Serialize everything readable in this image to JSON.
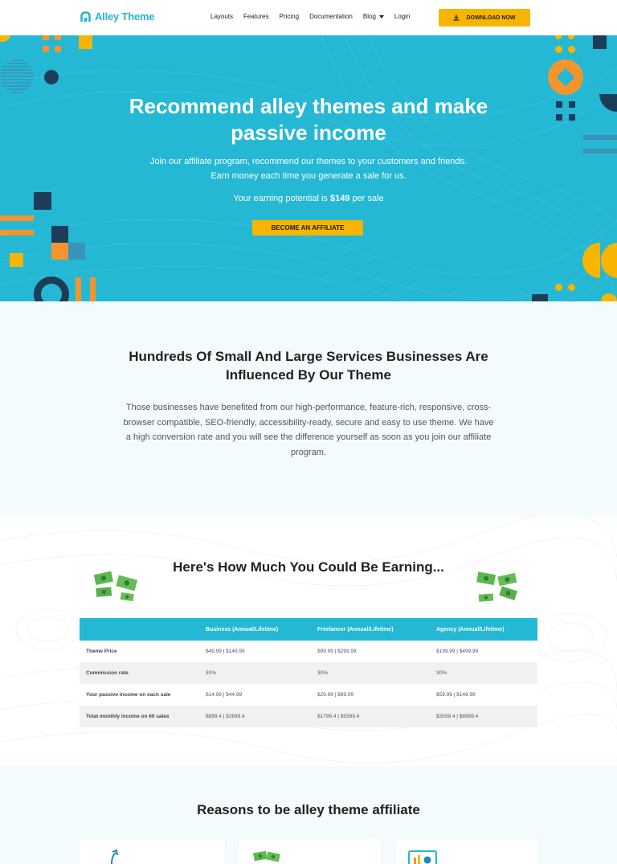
{
  "header": {
    "logo_text": "Alley Theme",
    "nav": [
      "Layouts",
      "Features",
      "Pricing",
      "Documentation",
      "Blog",
      "Login"
    ],
    "download_label": "DOWNLOAD NOW"
  },
  "hero": {
    "title_line1": "Recommend alley themes and make",
    "title_line2": "passive income",
    "sub_line1": "Join our affiliate program, recommend our themes to your customers and friends.",
    "sub_line2": "Earn money each time you generate a sale for us.",
    "earn_prefix": "Your earning potential is ",
    "earn_amount": "$149",
    "earn_suffix": " per sale",
    "cta_label": "BECOME AN AFFILIATE"
  },
  "influence": {
    "title_line1": "Hundreds Of Small And Large Services Businesses Are",
    "title_line2": "Influenced By Our Theme",
    "body": "Those businesses have benefited from our high-performance, feature-rich, responsive, cross-browser compatible, SEO-friendly, accessibility-ready, secure and easy to use theme. We have a high conversion rate and you will see the difference yourself as soon as you join our affiliate program."
  },
  "earnings": {
    "title": "Here's How Much You Could Be Earning...",
    "columns": [
      "",
      "Business (Annual/Lifetime)",
      "Freelancer (Annual/Lifetime)",
      "Agency (Annual/Lifetime)"
    ],
    "rows": [
      [
        "Theme Price",
        "$49.99 | $149.99",
        "$99.99 | $299.99",
        "$199.99 | $499.99"
      ],
      [
        "Commission rate",
        "30%",
        "30%",
        "30%"
      ],
      [
        "Your passive income on each sale",
        "$14.99 | $44.99",
        "$29.99 | $89.99",
        "$59.99 | $149.99"
      ],
      [
        "Total monthly income on 60 sales",
        "$899.4 | $2699.4",
        "$1799.4 | $5399.4",
        "$3599.4 | $8999.4"
      ]
    ]
  },
  "reasons": {
    "title": "Reasons to be alley theme affiliate"
  },
  "colors": {
    "brand": "#25b8d5",
    "accent": "#f7b500",
    "navy": "#1c3d5a",
    "orange": "#f3952c"
  }
}
